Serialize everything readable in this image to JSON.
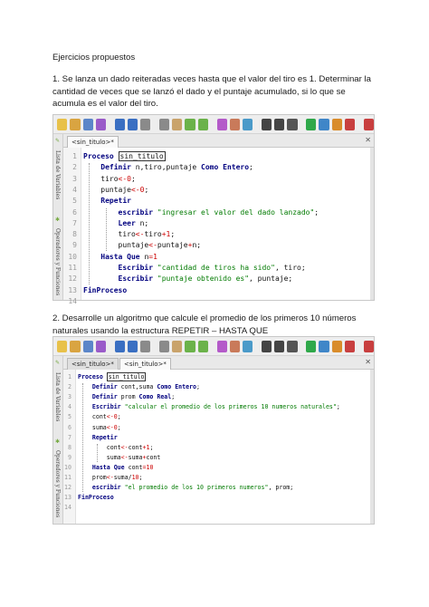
{
  "doc": {
    "heading": "Ejercicios propuestos",
    "ex1": "1.  Se lanza un dado reiteradas veces hasta que el valor del tiro es 1. Determinar la cantidad de veces que se lanzó el dado y el puntaje acumulado, si lo que se acumula es el valor del tiro.",
    "ex2": "2.  Desarrolle un algoritmo que calcule el promedio de los primeros 10 números naturales usando la estructura REPETIR – HASTA QUE"
  },
  "sidebar": {
    "vars_label": "Lista de Variables",
    "ops_label": "Operadores y Funciones"
  },
  "shot1": {
    "tabs": [
      "<sin_titulo>*"
    ],
    "line_numbers": [
      "1",
      "2",
      "3",
      "4",
      "5",
      "6",
      "7",
      "8",
      "9",
      "10",
      "11",
      "12",
      "13",
      "14"
    ],
    "code": [
      [
        [
          "kw",
          "Proceso"
        ],
        [
          "t",
          " "
        ],
        [
          "title",
          "sin_titulo"
        ]
      ],
      [
        [
          "t",
          "    "
        ],
        [
          "kw",
          "Definir"
        ],
        [
          "t",
          " n,tiro,puntaje "
        ],
        [
          "kw",
          "Como Entero"
        ],
        [
          "t",
          ";"
        ]
      ],
      [
        [
          "t",
          "    tiro"
        ],
        [
          "op",
          "<-"
        ],
        [
          "num",
          "0"
        ],
        [
          "t",
          ";"
        ]
      ],
      [
        [
          "t",
          "    puntaje"
        ],
        [
          "op",
          "<-"
        ],
        [
          "num",
          "0"
        ],
        [
          "t",
          ";"
        ]
      ],
      [
        [
          "t",
          "    "
        ],
        [
          "kw",
          "Repetir"
        ]
      ],
      [
        [
          "t",
          "        "
        ],
        [
          "kw",
          "escribir"
        ],
        [
          "t",
          " "
        ],
        [
          "str",
          "\"ingresar el valor del dado lanzado\""
        ],
        [
          "t",
          ";"
        ]
      ],
      [
        [
          "t",
          "        "
        ],
        [
          "kw",
          "Leer"
        ],
        [
          "t",
          " n;"
        ]
      ],
      [
        [
          "t",
          "        tiro"
        ],
        [
          "op",
          "<-"
        ],
        [
          "t",
          "tiro"
        ],
        [
          "op",
          "+"
        ],
        [
          "num",
          "1"
        ],
        [
          "t",
          ";"
        ]
      ],
      [
        [
          "t",
          "        puntaje"
        ],
        [
          "op",
          "<-"
        ],
        [
          "t",
          "puntaje"
        ],
        [
          "op",
          "+"
        ],
        [
          "t",
          "n;"
        ]
      ],
      [
        [
          "t",
          "    "
        ],
        [
          "kw",
          "Hasta Que"
        ],
        [
          "t",
          " n"
        ],
        [
          "op",
          "="
        ],
        [
          "num",
          "1"
        ]
      ],
      [
        [
          "t",
          "        "
        ],
        [
          "kw",
          "Escribir"
        ],
        [
          "t",
          " "
        ],
        [
          "str",
          "\"cantidad de tiros ha sido\""
        ],
        [
          "t",
          ", tiro;"
        ]
      ],
      [
        [
          "t",
          "        "
        ],
        [
          "kw",
          "Escribir"
        ],
        [
          "t",
          " "
        ],
        [
          "str",
          "\"puntaje obtenido es\""
        ],
        [
          "t",
          ", puntaje;"
        ]
      ],
      [
        [
          "kw",
          "FinProceso"
        ]
      ],
      []
    ]
  },
  "shot2": {
    "tabs": [
      "<sin_titulo>*",
      "<sin_titulo>*"
    ],
    "line_numbers": [
      "1",
      "2",
      "3",
      "4",
      "5",
      "6",
      "7",
      "8",
      "9",
      "10",
      "11",
      "12",
      "13",
      "14"
    ],
    "code": [
      [
        [
          "kw",
          "Proceso"
        ],
        [
          "t",
          " "
        ],
        [
          "title",
          "sin_titulo"
        ]
      ],
      [
        [
          "t",
          "    "
        ],
        [
          "kw",
          "Definir"
        ],
        [
          "t",
          " cont,suma "
        ],
        [
          "kw",
          "Como Entero"
        ],
        [
          "t",
          ";"
        ]
      ],
      [
        [
          "t",
          "    "
        ],
        [
          "kw",
          "Definir"
        ],
        [
          "t",
          " prom "
        ],
        [
          "kw",
          "Como Real"
        ],
        [
          "t",
          ";"
        ]
      ],
      [
        [
          "t",
          "    "
        ],
        [
          "kw",
          "Escribir"
        ],
        [
          "t",
          " "
        ],
        [
          "str",
          "\"calcular el promedio de los primeros 10 numeros naturales\""
        ],
        [
          "t",
          ";"
        ]
      ],
      [
        [
          "t",
          "    cont"
        ],
        [
          "op",
          "<-"
        ],
        [
          "num",
          "0"
        ],
        [
          "t",
          ";"
        ]
      ],
      [
        [
          "t",
          "    suma"
        ],
        [
          "op",
          "<-"
        ],
        [
          "num",
          "0"
        ],
        [
          "t",
          ";"
        ]
      ],
      [
        [
          "t",
          "    "
        ],
        [
          "kw",
          "Repetir"
        ]
      ],
      [
        [
          "t",
          "        cont"
        ],
        [
          "op",
          "<-"
        ],
        [
          "t",
          "cont"
        ],
        [
          "op",
          "+"
        ],
        [
          "num",
          "1"
        ],
        [
          "t",
          ";"
        ]
      ],
      [
        [
          "t",
          "        suma"
        ],
        [
          "op",
          "<-"
        ],
        [
          "t",
          "suma"
        ],
        [
          "op",
          "+"
        ],
        [
          "t",
          "cont"
        ]
      ],
      [
        [
          "t",
          "    "
        ],
        [
          "kw",
          "Hasta Que"
        ],
        [
          "t",
          " cont"
        ],
        [
          "op",
          "="
        ],
        [
          "num",
          "10"
        ]
      ],
      [
        [
          "t",
          "    prom"
        ],
        [
          "op",
          "<-"
        ],
        [
          "t",
          "suma/"
        ],
        [
          "num",
          "10"
        ],
        [
          "t",
          ";"
        ]
      ],
      [
        [
          "t",
          "    "
        ],
        [
          "kw",
          "escribir"
        ],
        [
          "t",
          " "
        ],
        [
          "str",
          "\"el promedio de los 10 primeros numeros\""
        ],
        [
          "t",
          ", prom;"
        ]
      ],
      [
        [
          "kw",
          "FinProceso"
        ]
      ],
      []
    ]
  },
  "toolbar_icons": [
    "new-icon",
    "open-icon",
    "save-icon",
    "save-as-icon",
    "undo-icon",
    "redo-icon",
    "cut-icon",
    "copy-icon",
    "paste-icon",
    "move-up-icon",
    "move-down-icon",
    "comment-icon",
    "uncomment-icon",
    "indent-icon",
    "find-icon",
    "find-next-icon",
    "replace-icon",
    "run-icon",
    "step-icon",
    "debug-icon",
    "flowchart-icon",
    "help-icon"
  ],
  "colors": {
    "keyword": "#00007f",
    "string": "#007a00",
    "number": "#cc0000",
    "gutter": "#f4f4f4"
  }
}
